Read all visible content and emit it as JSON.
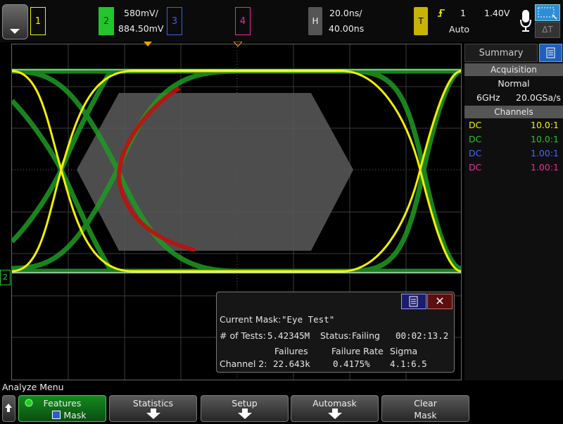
{
  "topbar": {
    "ch1": {
      "label": "1",
      "color": "#f2f200"
    },
    "ch2": {
      "label": "2",
      "color": "#22c52a",
      "scale": "580mV/",
      "offset": "884.50mV"
    },
    "ch3": {
      "label": "3",
      "color": "#3b5cff"
    },
    "ch4": {
      "label": "4",
      "color": "#ee2a9a"
    },
    "horizontal": {
      "label": "H",
      "timebase": "20.0ns/",
      "position": "40.00ns"
    },
    "trigger": {
      "label": "T",
      "source": "1",
      "level": "1.40V",
      "mode": "Auto"
    },
    "delta_label": "ΔT"
  },
  "panel": {
    "tab": "Summary",
    "acquisition_title": "Acquisition",
    "acq_mode": "Normal",
    "bandwidth": "6GHz",
    "sample_rate": "20.0GSa/s",
    "channels_title": "Channels",
    "channels": [
      {
        "coupling": "DC",
        "probe": "10.0:1",
        "color": "#f2f200"
      },
      {
        "coupling": "DC",
        "probe": "10.0:1",
        "color": "#22c52a"
      },
      {
        "coupling": "DC",
        "probe": "1.00:1",
        "color": "#4a66ff"
      },
      {
        "coupling": "DC",
        "probe": "1.00:1",
        "color": "#ee2a9a"
      }
    ]
  },
  "mask_dialog": {
    "current_mask_label": "Current Mask:",
    "current_mask_value": "\"Eye Test\"",
    "tests_label": "# of Tests:",
    "tests_value": "5.42345M",
    "status_label": "Status:",
    "status_value": "Failing",
    "elapsed": "00:02:13.2",
    "col_failures": "Failures",
    "col_rate": "Failure Rate",
    "col_sigma": "Sigma",
    "row_label": "Channel 2:",
    "failures": "22.643k",
    "failure_rate": "0.4175%",
    "sigma": "4.1:6.5"
  },
  "softkeys": {
    "menu_title": "Analyze Menu",
    "features": "Features",
    "mask": "Mask",
    "statistics": "Statistics",
    "setup": "Setup",
    "automask": "Automask",
    "clear_l1": "Clear",
    "clear_l2": "Mask"
  },
  "ground_marker": "2"
}
